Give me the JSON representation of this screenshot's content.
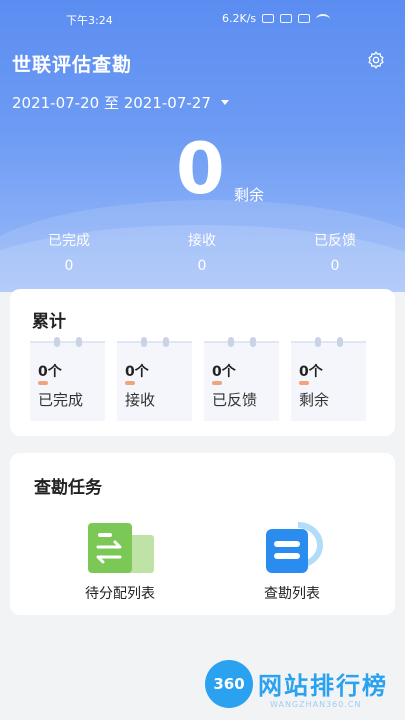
{
  "status": {
    "time": "下午3:24",
    "speed": "6.2K/s"
  },
  "header": {
    "title": "世联评估查勘",
    "date_range": "2021-07-20 至 2021-07-27",
    "remaining_value": "0",
    "remaining_label": "剩余"
  },
  "summary": [
    {
      "label": "已完成",
      "value": "0"
    },
    {
      "label": "接收",
      "value": "0"
    },
    {
      "label": "已反馈",
      "value": "0"
    }
  ],
  "cumulative": {
    "title": "累计",
    "tiles": [
      {
        "count": "0个",
        "label": "已完成"
      },
      {
        "count": "0个",
        "label": "接收"
      },
      {
        "count": "0个",
        "label": "已反馈"
      },
      {
        "count": "0个",
        "label": "剩余"
      }
    ]
  },
  "tasks": {
    "title": "查勘任务",
    "items": [
      {
        "label": "待分配列表",
        "icon": "assign-list-icon"
      },
      {
        "label": "查勘列表",
        "icon": "survey-list-icon"
      }
    ]
  },
  "watermark": {
    "text": "网站排行榜",
    "badge": "360",
    "sub": "WANGZHAN360.CN"
  },
  "colors": {
    "header": "#5b8df1",
    "accent_green": "#7cc856",
    "accent_blue": "#2b8cf0",
    "dash": "#f1a37c"
  }
}
